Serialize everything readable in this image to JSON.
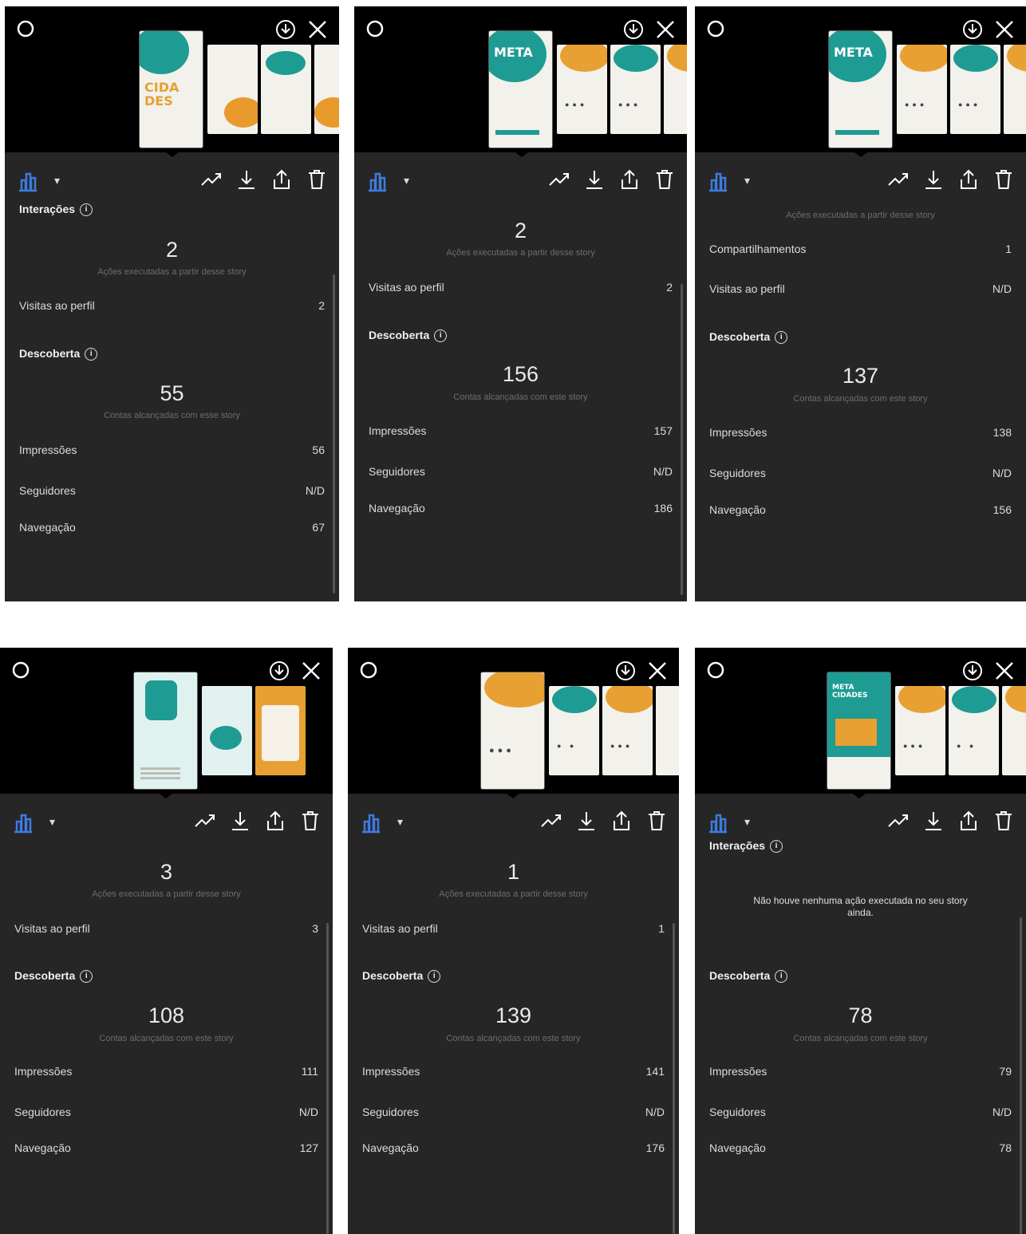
{
  "screens": [
    {
      "interacoes_title": "Interações",
      "acoes_value": "2",
      "acoes_label": "Ações executadas a partir desse story",
      "visitas_label": "Visitas ao perfil",
      "visitas_value": "2",
      "descoberta_title": "Descoberta",
      "contas_value": "55",
      "contas_label": "Contas alcançadas com esse story",
      "impressoes_label": "Impressões",
      "impressoes_value": "56",
      "seguidores_label": "Seguidores",
      "seguidores_value": "N/D",
      "navegacao_label": "Navegação",
      "navegacao_value": "67"
    },
    {
      "acoes_value": "2",
      "acoes_label": "Ações executadas a partir desse story",
      "visitas_label": "Visitas ao perfil",
      "visitas_value": "2",
      "descoberta_title": "Descoberta",
      "contas_value": "156",
      "contas_label": "Contas alcançadas com este story",
      "impressoes_label": "Impressões",
      "impressoes_value": "157",
      "seguidores_label": "Seguidores",
      "seguidores_value": "N/D",
      "navegacao_label": "Navegação",
      "navegacao_value": "186"
    },
    {
      "acoes_label": "Ações executadas a partir desse story",
      "compart_label": "Compartilhamentos",
      "compart_value": "1",
      "visitas_label": "Visitas ao perfil",
      "visitas_value": "N/D",
      "descoberta_title": "Descoberta",
      "contas_value": "137",
      "contas_label": "Contas alcançadas com este story",
      "impressoes_label": "Impressões",
      "impressoes_value": "138",
      "seguidores_label": "Seguidores",
      "seguidores_value": "N/D",
      "navegacao_label": "Navegação",
      "navegacao_value": "156"
    },
    {
      "acoes_value": "3",
      "acoes_label": "Ações executadas a partir desse story",
      "visitas_label": "Visitas ao perfil",
      "visitas_value": "3",
      "descoberta_title": "Descoberta",
      "contas_value": "108",
      "contas_label": "Contas alcançadas com este story",
      "impressoes_label": "Impressões",
      "impressoes_value": "111",
      "seguidores_label": "Seguidores",
      "seguidores_value": "N/D",
      "navegacao_label": "Navegação",
      "navegacao_value": "127"
    },
    {
      "acoes_value": "1",
      "acoes_label": "Ações executadas a partir desse story",
      "visitas_label": "Visitas ao perfil",
      "visitas_value": "1",
      "descoberta_title": "Descoberta",
      "contas_value": "139",
      "contas_label": "Contas alcançadas com este story",
      "impressoes_label": "Impressões",
      "impressoes_value": "141",
      "seguidores_label": "Seguidores",
      "seguidores_value": "N/D",
      "navegacao_label": "Navegação",
      "navegacao_value": "176"
    },
    {
      "interacoes_title": "Interações",
      "no_actions": "Não houve nenhuma ação executada no seu story ainda.",
      "descoberta_title": "Descoberta",
      "contas_value": "78",
      "contas_label": "Contas alcançadas com este story",
      "impressoes_label": "Impressões",
      "impressoes_value": "79",
      "seguidores_label": "Seguidores",
      "seguidores_value": "N/D",
      "navegacao_label": "Navegação",
      "navegacao_value": "78"
    }
  ],
  "thumb_text": {
    "meta": "META",
    "cidades": "CIDA DES",
    "metas": "META CIDADES"
  },
  "colors": {
    "panel_bg": "#262626",
    "teal": "#1e9b93",
    "orange": "#e8a033",
    "accent_blue": "#3d7be0"
  },
  "icons": [
    "gear-icon",
    "download-circle-icon",
    "close-icon",
    "bar-chart-icon",
    "chevron-down-icon",
    "trend-icon",
    "download-icon",
    "share-icon",
    "trash-icon",
    "info-icon"
  ]
}
